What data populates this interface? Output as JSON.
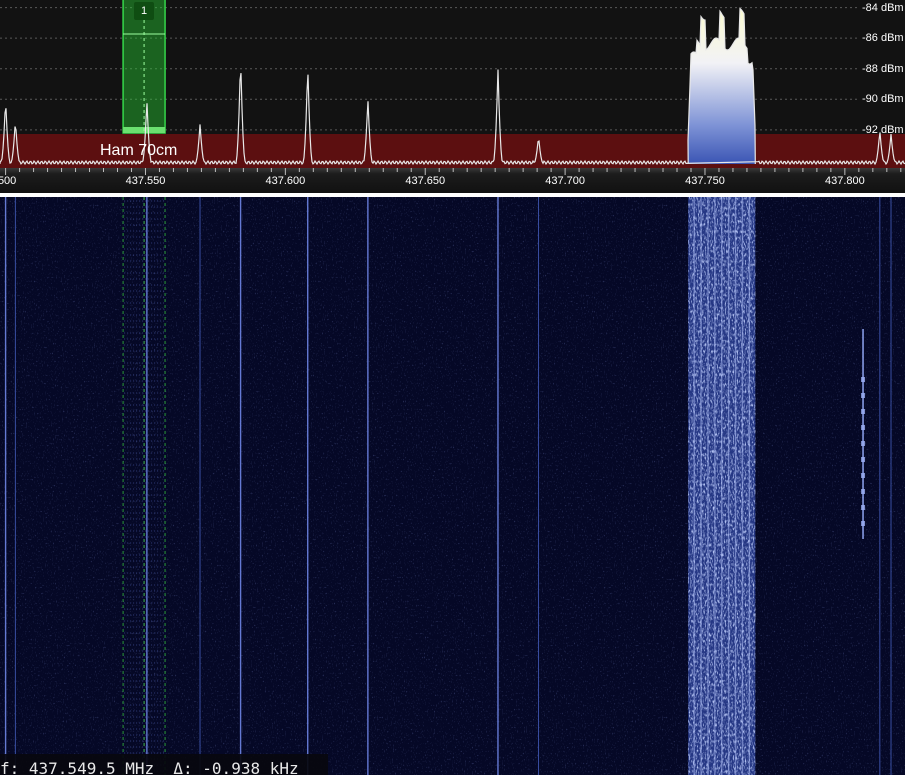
{
  "spectrum": {
    "db_labels": [
      "-84 dBm",
      "-86 dBm",
      "-88 dBm",
      "-90 dBm",
      "-92 dBm"
    ],
    "db_values": [
      -84,
      -86,
      -88,
      -90,
      -92
    ],
    "db_range": [
      -83.5,
      -94.5
    ],
    "band_label": "Ham 70cm",
    "vfo_number": "1"
  },
  "frequency_axis": {
    "unit": "MHz",
    "visible_range_mhz": [
      437.498,
      437.8215
    ],
    "labels": [
      ".500",
      "437.550",
      "437.600",
      "437.650",
      "437.700",
      "437.750",
      "437.800"
    ],
    "label_values": [
      437.5,
      437.55,
      437.6,
      437.65,
      437.7,
      437.75,
      437.8
    ]
  },
  "vfo": {
    "center_mhz": 437.5495,
    "bandwidth_khz": 15
  },
  "signals": {
    "carriers_mhz": [
      437.5,
      437.5035,
      437.5505,
      437.5695,
      437.584,
      437.608,
      437.6295,
      437.676,
      437.6905,
      437.8125,
      437.8165
    ],
    "wideband": {
      "center_mhz": 437.756,
      "width_khz": 24
    },
    "burst": {
      "center_mhz": 437.8065
    }
  },
  "status": {
    "frequency_text": "f: 437.549.5 MHz",
    "delta_text": "Δ: -0.938 kHz"
  },
  "colors": {
    "spectrum_bg": "#121212",
    "band_bar": "#5c0f10",
    "waterfall_bg": "#050826",
    "vfo_green": "#2bbf3a",
    "signal_blue": "#6f8fe0"
  }
}
